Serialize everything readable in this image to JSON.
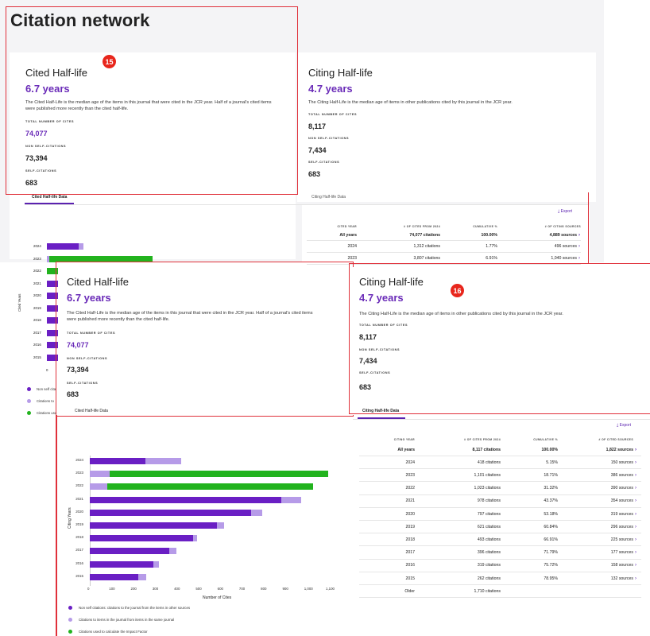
{
  "colors": {
    "accent": "#6a2bb8",
    "non_self": "#6a1fc4",
    "same_journal": "#b69be8",
    "impact": "#22b31e",
    "annotation_red": "#e0303a"
  },
  "page": {
    "title": "Citation network"
  },
  "badges": {
    "b15": "15",
    "b16": "16"
  },
  "cited": {
    "title": "Cited Half-life",
    "years": "6.7 years",
    "desc1": "The Cited Half-Life is the median age of the items in this journal that were cited in the JCR year. Half of a journal's cited items",
    "desc2": "were published more recently than the cited half-life.",
    "total_label": "TOTAL NUMBER OF CITES",
    "total_value": "74,077",
    "nonself_label": "NON SELF-CITATIONS",
    "nonself_value": "73,394",
    "self_label": "SELF-CITATIONS",
    "self_value": "683",
    "tab": "Cited Half-life Data"
  },
  "citing": {
    "title": "Citing Half-life",
    "years": "4.7 years",
    "desc": "The Citing Half-Life is the median age of items in other publications cited by this journal in the JCR year.",
    "total_label": "TOTAL NUMBER OF CITES",
    "total_value": "8,117",
    "nonself_label": "NON SELF-CITATIONS",
    "nonself_value": "7,434",
    "self_label": "SELF-CITATIONS",
    "self_value": "683",
    "tab": "Citing Half-life Data"
  },
  "cited_table": {
    "export": "Export",
    "headers": [
      "CITED YEAR",
      "# OF CITES FROM 2024",
      "CUMULATIVE %",
      "# OF CITING SOURCES"
    ],
    "rows": [
      [
        "All years",
        "74,077 citations",
        "100.00%",
        "4,889 sources"
      ],
      [
        "2024",
        "1,312 citations",
        "1.77%",
        "496 sources"
      ],
      [
        "2023",
        "3,807 citations",
        "6.91%",
        "1,040 sources"
      ]
    ]
  },
  "cited_mini_chart": {
    "ylabel": "Cited Years",
    "years": [
      "2024",
      "2023",
      "2022",
      "2021",
      "2020",
      "2019",
      "2018",
      "2017",
      "2016",
      "2015"
    ],
    "zero": "0",
    "legend": [
      "Non self cita",
      "Citations to",
      "Citations use"
    ]
  },
  "citing_table": {
    "export": "Export",
    "headers": [
      "CITING YEAR",
      "# OF CITES FROM 2024",
      "CUMULATIVE %",
      "# OF CITED SOURCES"
    ],
    "rows": [
      [
        "All years",
        "8,117 citations",
        "100.00%",
        "1,822 sources"
      ],
      [
        "2024",
        "418 citations",
        "5.15%",
        "150 sources"
      ],
      [
        "2023",
        "1,101 citations",
        "18.71%",
        "386 sources"
      ],
      [
        "2022",
        "1,023 citations",
        "31.32%",
        "390 sources"
      ],
      [
        "2021",
        "978 citations",
        "43.37%",
        "354 sources"
      ],
      [
        "2020",
        "797 citations",
        "53.18%",
        "319 sources"
      ],
      [
        "2019",
        "621 citations",
        "60.84%",
        "296 sources"
      ],
      [
        "2018",
        "493 citations",
        "66.91%",
        "225 sources"
      ],
      [
        "2017",
        "396 citations",
        "71.79%",
        "177 sources"
      ],
      [
        "2016",
        "319 citations",
        "75.72%",
        "158 sources"
      ],
      [
        "2015",
        "262 citations",
        "78.95%",
        "132 sources"
      ],
      [
        "Older",
        "1,710 citations",
        "",
        ""
      ]
    ]
  },
  "chart_data": {
    "type": "bar",
    "orientation": "horizontal",
    "stacked": true,
    "categories": [
      "2024",
      "2023",
      "2022",
      "2021",
      "2020",
      "2019",
      "2018",
      "2017",
      "2016",
      "2015"
    ],
    "series": [
      {
        "name": "Non self citations: citations to the journal from the items in other sources",
        "color": "#6a1fc4",
        "values": [
          255,
          0,
          0,
          885,
          745,
          585,
          475,
          365,
          295,
          225
        ]
      },
      {
        "name": "Citations to items in the journal from items in the same journal",
        "color": "#b69be8",
        "values": [
          165,
          90,
          80,
          90,
          50,
          35,
          20,
          35,
          25,
          35
        ]
      },
      {
        "name": "Citations used to calculate the Impact Factor",
        "color": "#22b31e",
        "values": [
          0,
          1010,
          950,
          0,
          0,
          0,
          0,
          0,
          0,
          0
        ]
      }
    ],
    "xlabel": "Number of Cites",
    "ylabel": "Citing Years",
    "xticks": [
      "0",
      "100",
      "200",
      "300",
      "400",
      "500",
      "600",
      "700",
      "800",
      "900",
      "1,000",
      "1,100"
    ],
    "xlim": [
      0,
      1100
    ],
    "legend_position": "bottom",
    "legend": [
      "Non self citations: citations to the journal from the items in other sources",
      "Citations to items in the journal from items in the same journal",
      "Citations used to calculate the Impact Factor"
    ]
  }
}
